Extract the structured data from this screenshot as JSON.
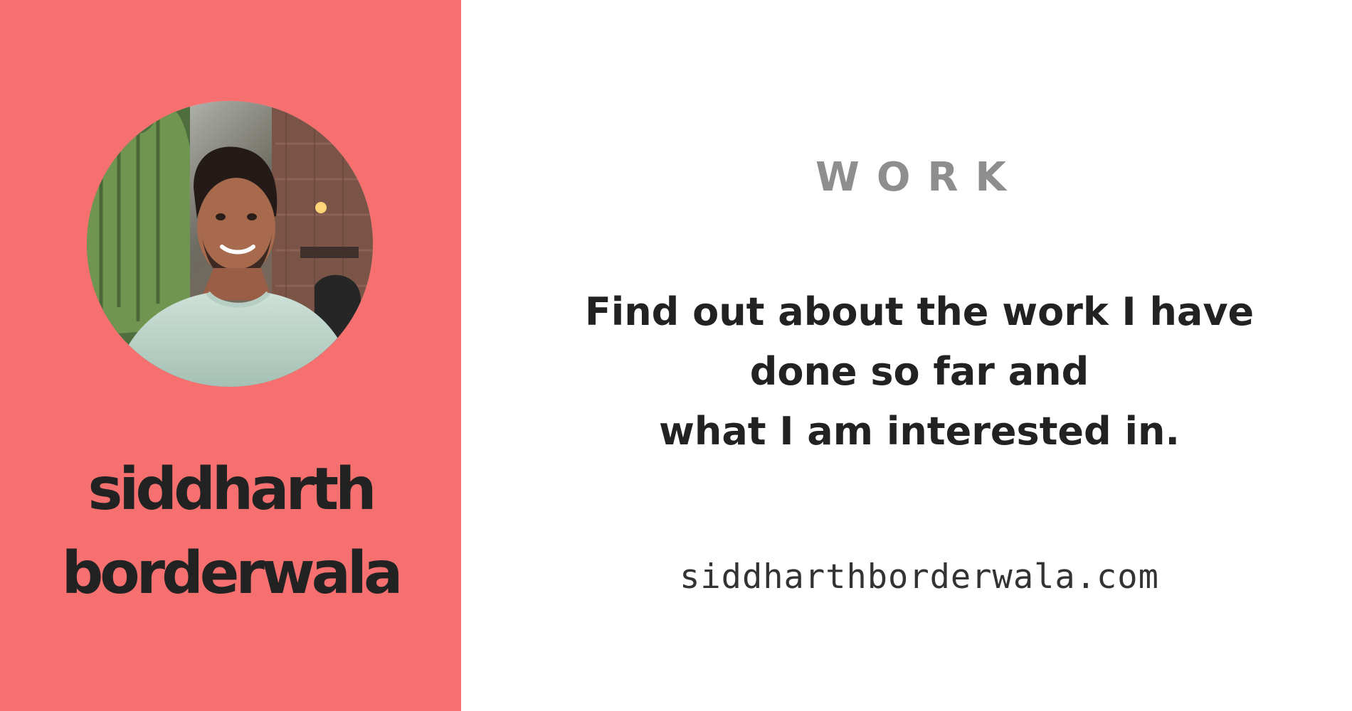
{
  "colors": {
    "left_panel": "#f77070",
    "right_panel": "#ffffff",
    "heading": "#8e8e8e",
    "text": "#222222"
  },
  "profile": {
    "avatar": "profile-photo",
    "name_line_1": "siddharth",
    "name_line_2": "borderwala"
  },
  "content": {
    "section_heading": "WORK",
    "description_lines": [
      "Find out about the work I have",
      "done so far and",
      "what I am interested in."
    ],
    "website": "siddharthborderwala.com"
  }
}
